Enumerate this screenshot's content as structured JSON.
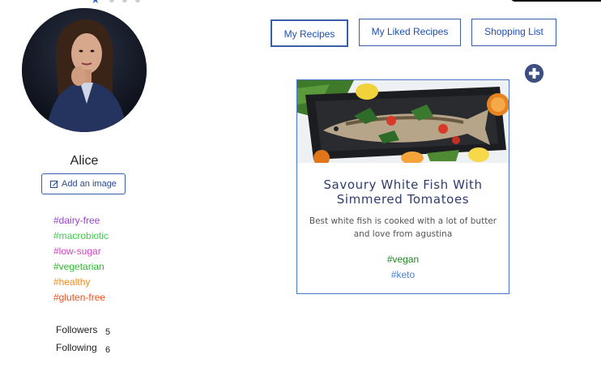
{
  "profile": {
    "username": "Alice",
    "add_image_label": "Add an image",
    "tags": [
      {
        "label": "#dairy-free",
        "color": "#9b3fd4"
      },
      {
        "label": "#macrobiotic",
        "color": "#3ecb4a"
      },
      {
        "label": "#low-sugar",
        "color": "#d63ec8"
      },
      {
        "label": "#vegetarian",
        "color": "#2eb82e"
      },
      {
        "label": "#healthy",
        "color": "#f08a1c"
      },
      {
        "label": "#gluten-free",
        "color": "#e8511d"
      }
    ],
    "followers_label": "Followers",
    "followers_count": "5",
    "following_label": "Following",
    "following_count": "6"
  },
  "tabs": {
    "my_recipes": "My Recipes",
    "liked_recipes": "My Liked Recipes",
    "shopping_list": "Shopping List"
  },
  "recipe_card": {
    "title": "Savoury White Fish With Simmered Tomatoes",
    "description": "Best white fish is cooked with a lot of butter and love from agustina",
    "tags": [
      {
        "label": "#vegan",
        "color": "#1f8a1f"
      },
      {
        "label": "#keto",
        "color": "#4a7fd4"
      }
    ]
  },
  "icons": {
    "add": "plus-circle-icon",
    "edit": "edit-icon"
  }
}
